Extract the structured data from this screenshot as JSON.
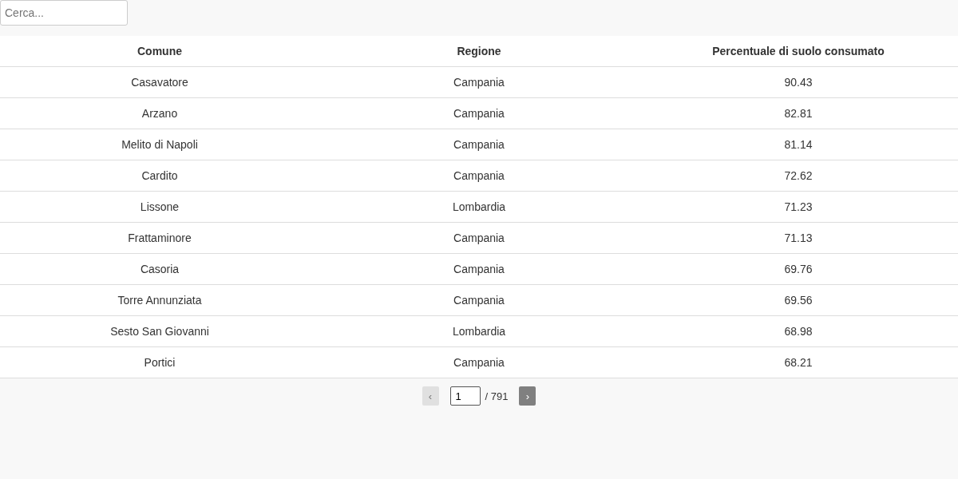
{
  "search": {
    "placeholder": "Cerca..."
  },
  "table": {
    "columns": [
      "Comune",
      "Regione",
      "Percentuale di suolo consumato"
    ],
    "rows": [
      [
        "Casavatore",
        "Campania",
        "90.43"
      ],
      [
        "Arzano",
        "Campania",
        "82.81"
      ],
      [
        "Melito di Napoli",
        "Campania",
        "81.14"
      ],
      [
        "Cardito",
        "Campania",
        "72.62"
      ],
      [
        "Lissone",
        "Lombardia",
        "71.23"
      ],
      [
        "Frattaminore",
        "Campania",
        "71.13"
      ],
      [
        "Casoria",
        "Campania",
        "69.76"
      ],
      [
        "Torre Annunziata",
        "Campania",
        "69.56"
      ],
      [
        "Sesto San Giovanni",
        "Lombardia",
        "68.98"
      ],
      [
        "Portici",
        "Campania",
        "68.21"
      ]
    ]
  },
  "pagination": {
    "prev": {
      "label": "‹",
      "disabled": true
    },
    "page": "1",
    "total": "/ 791",
    "next": {
      "label": "›",
      "disabled": false
    }
  }
}
